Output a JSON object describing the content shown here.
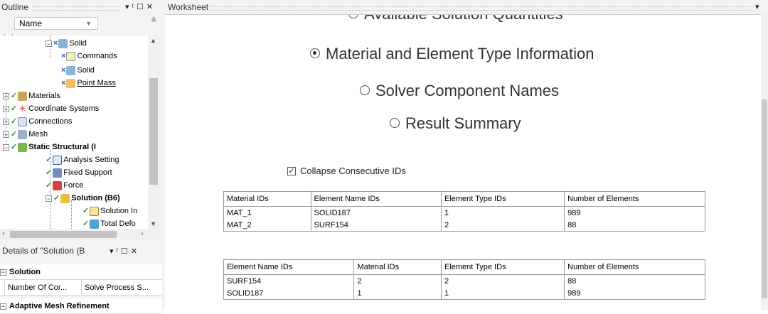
{
  "outline": {
    "title": "Outline",
    "name_filter": "Name",
    "tree": [
      {
        "label": "Solid",
        "icon": "solid-body-icon",
        "status": "check"
      },
      {
        "label": "Commands",
        "icon": "commands-icon",
        "status": "x"
      },
      {
        "label": "Solid",
        "icon": "solid-body-icon",
        "status": "x"
      },
      {
        "label": "Point Mass",
        "icon": "point-mass-icon",
        "status": "x"
      },
      {
        "label": "Materials",
        "icon": "materials-icon",
        "status": "check"
      },
      {
        "label": "Coordinate Systems",
        "icon": "coordinate-systems-icon",
        "status": "check"
      },
      {
        "label": "Connections",
        "icon": "connections-icon",
        "status": "check"
      },
      {
        "label": "Mesh",
        "icon": "mesh-icon",
        "status": "check"
      },
      {
        "label": "Static Structural (I",
        "icon": "static-structural-icon",
        "status": "check"
      },
      {
        "label": "Analysis Setting",
        "icon": "analysis-settings-icon",
        "status": "check"
      },
      {
        "label": "Fixed Support",
        "icon": "fixed-support-icon",
        "status": "check"
      },
      {
        "label": "Force",
        "icon": "force-icon",
        "status": "check"
      },
      {
        "label": "Solution (B6)",
        "icon": "solution-icon",
        "status": "check"
      },
      {
        "label": "Solution In",
        "icon": "solution-info-icon",
        "status": "check"
      },
      {
        "label": "Total Defo",
        "icon": "total-deformation-icon",
        "status": "check"
      }
    ]
  },
  "details": {
    "title": "Details of \"Solution (B",
    "groups": [
      {
        "label": "Solution"
      },
      {
        "label": "Adaptive Mesh Refinement"
      }
    ],
    "row": {
      "col1": "Number Of Cor...",
      "col2": "Solve Process S..."
    }
  },
  "worksheet": {
    "title": "Worksheet",
    "options": [
      {
        "label": "Available Solution Quantities",
        "selected": false
      },
      {
        "label": "Material and Element Type Information",
        "selected": true
      },
      {
        "label": "Solver Component Names",
        "selected": false
      },
      {
        "label": "Result Summary",
        "selected": false
      }
    ],
    "collapse_label": "Collapse Consecutive IDs",
    "collapse_checked": true,
    "table1": {
      "headers": [
        "Material IDs",
        "Element Name IDs",
        "Element Type IDs",
        "Number of Elements"
      ],
      "rows": [
        [
          "MAT_1",
          "SOLID187",
          "1",
          "989"
        ],
        [
          "MAT_2",
          "SURF154",
          "2",
          "88"
        ]
      ]
    },
    "table2": {
      "headers": [
        "Element Name IDs",
        "Material IDs",
        "Element Type IDs",
        "Number of Elements"
      ],
      "rows": [
        [
          "SURF154",
          "2",
          "2",
          "88"
        ],
        [
          "SOLID187",
          "1",
          "1",
          "989"
        ]
      ]
    }
  },
  "colors": {
    "check": "#2a9d2a",
    "x_mark": "#1f5fbf",
    "panel_bg": "#f3f3f3"
  }
}
